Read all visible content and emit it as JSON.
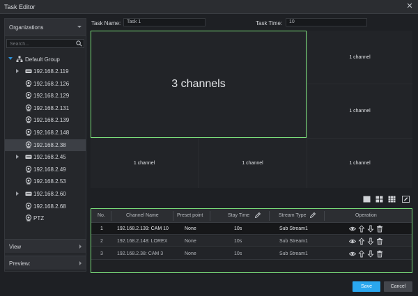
{
  "window": {
    "title": "Task Editor"
  },
  "sidebar": {
    "organizations_label": "Organizations",
    "search_placeholder": "Search...",
    "group_label": "Default Group",
    "nodes": [
      {
        "label": "192.168.2.119",
        "kind": "nvr",
        "expandable": true
      },
      {
        "label": "192.168.2.126",
        "kind": "camera"
      },
      {
        "label": "192.168.2.129",
        "kind": "camera"
      },
      {
        "label": "192.168.2.131",
        "kind": "camera"
      },
      {
        "label": "192.168.2.139",
        "kind": "camera"
      },
      {
        "label": "192.168.2.148",
        "kind": "camera"
      },
      {
        "label": "192.168.2.38",
        "kind": "camera",
        "selected": true
      },
      {
        "label": "192.168.2.45",
        "kind": "nvr",
        "expandable": true
      },
      {
        "label": "192.168.2.49",
        "kind": "camera"
      },
      {
        "label": "192.168.2.53",
        "kind": "camera"
      },
      {
        "label": "192.168.2.60",
        "kind": "nvr",
        "expandable": true
      },
      {
        "label": "192.168.2.68",
        "kind": "camera"
      },
      {
        "label": "PTZ",
        "kind": "camera"
      }
    ],
    "view_label": "View",
    "preview_label": "Preview:"
  },
  "task": {
    "name_label": "Task Name:",
    "name_value": "Task 1",
    "time_label": "Task Time:",
    "time_value": "10"
  },
  "grid": {
    "big_cell": "3 channels",
    "small_cell": "1 channel"
  },
  "table": {
    "headers": [
      "No.",
      "Channel Name",
      "Preset point",
      "Stay Time",
      "Stream Type",
      "Operation"
    ],
    "rows": [
      {
        "no": "1",
        "channel": "192.168.2.139: CAM 10",
        "preset": "None",
        "stay": "10s",
        "stream": "Sub Stream1"
      },
      {
        "no": "2",
        "channel": "192.168.2.148: LOREX",
        "preset": "None",
        "stay": "10s",
        "stream": "Sub Stream1"
      },
      {
        "no": "3",
        "channel": "192.168.2.38: CAM 3",
        "preset": "None",
        "stay": "10s",
        "stream": "Sub Stream1"
      }
    ]
  },
  "buttons": {
    "save": "Save",
    "cancel": "Cancel"
  },
  "colors": {
    "accent": "#2aa7ef",
    "highlight_border": "#7be07b",
    "tree_caret": "#2c8fd6"
  }
}
